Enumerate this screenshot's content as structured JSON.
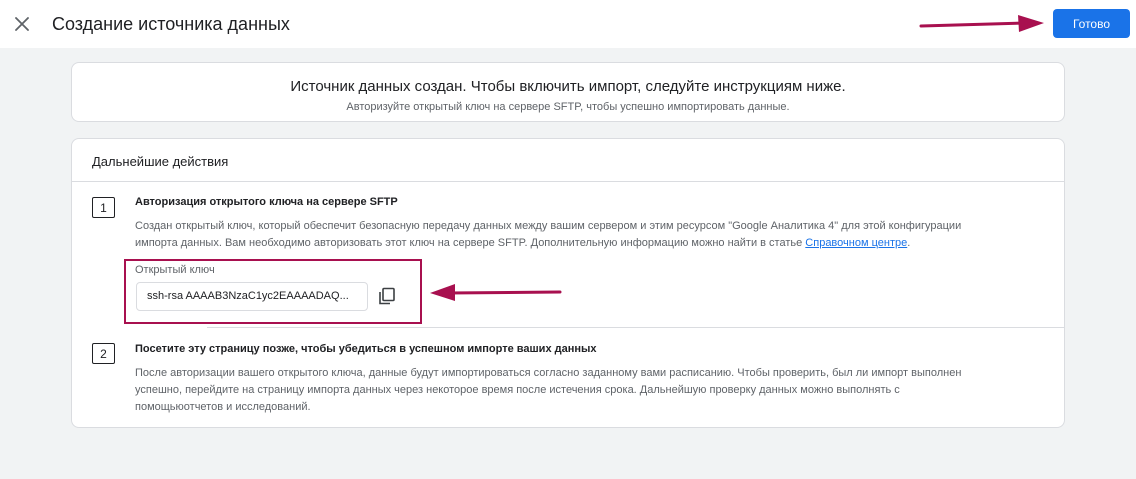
{
  "header": {
    "title": "Создание источника данных",
    "done_label": "Готово",
    "close_icon": "close-icon"
  },
  "status": {
    "main": "Источник данных создан. Чтобы включить импорт, следуйте инструкциям ниже.",
    "sub": "Авторизуйте открытый ключ на сервере SFTP, чтобы успешно импортировать данные."
  },
  "steps": {
    "heading": "Дальнейшие действия",
    "items": [
      {
        "num": "1",
        "title": "Авторизация открытого ключа на сервере SFTP",
        "desc_line1": "Создан открытый ключ, который обеспечит безопасную передачу данных между вашим сервером и этим ресурсом \"Google Аналитика 4\" для этой конфигурации",
        "desc_line2": "импорта данных. Вам необходимо авторизовать этот ключ на сервере SFTP. Дополнительную информацию можно найти в статье ",
        "link": "Справочном центре",
        "desc_end": "."
      },
      {
        "num": "2",
        "title": "Посетите эту страницу позже, чтобы убедиться в успешном импорте ваших данных",
        "desc_line1": "После авторизации вашего открытого ключа, данные будут импортироваться согласно заданному вами расписанию. Чтобы проверить, был ли импорт выполнен",
        "desc_line2": "успешно, перейдите на страницу импорта данных через некоторое время после истечения срока. Дальнейшую проверку данных можно выполнять с",
        "desc_line3": "помощьюотчетов и исследований."
      }
    ]
  },
  "public_key": {
    "label": "Открытый ключ",
    "value": "ssh-rsa AAAAB3NzaC1yc2EAAAADAQ...",
    "copy_icon": "copy-icon"
  },
  "colors": {
    "accent": "#1a73e8",
    "annotation": "#a8104f"
  }
}
